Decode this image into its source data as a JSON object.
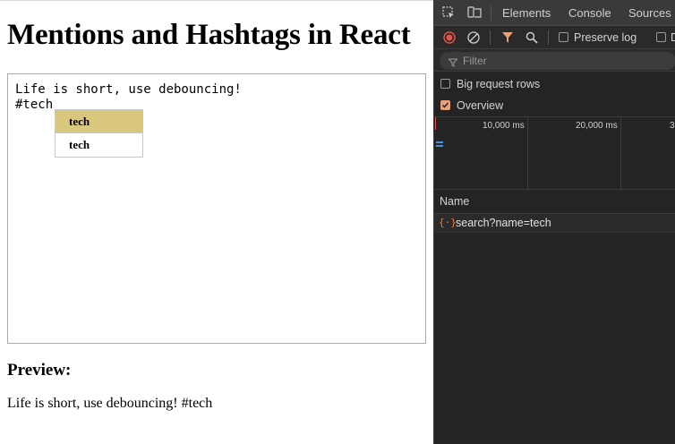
{
  "page": {
    "title": "Mentions and Hashtags in React",
    "editor": {
      "lines": [
        "Life is short, use debouncing!",
        "#tech"
      ]
    },
    "suggestions": [
      "tech",
      "tech"
    ],
    "preview_heading": "Preview:",
    "preview_text": "Life is short, use debouncing! #tech"
  },
  "devtools": {
    "tabs": [
      "Elements",
      "Console",
      "Sources"
    ],
    "icons": [
      "inspect-icon",
      "device-toggle-icon",
      "record-icon",
      "clear-icon",
      "filter-icon",
      "search-icon"
    ],
    "preserve_log": "Preserve log",
    "next_checkbox_label_partial": "D",
    "filter_placeholder": "Filter",
    "big_request_rows": "Big request rows",
    "big_request_rows_checked": false,
    "overview": "Overview",
    "overview_checked": true,
    "timeline_ticks": [
      "10,000 ms",
      "20,000 ms",
      "3"
    ],
    "name_header": "Name",
    "requests": [
      {
        "icon": "{·}",
        "name": "search?name=tech"
      }
    ],
    "colors": {
      "record": "#e5534b",
      "accent": "#e8a17a",
      "fetch_icon": "#e6813d"
    }
  }
}
